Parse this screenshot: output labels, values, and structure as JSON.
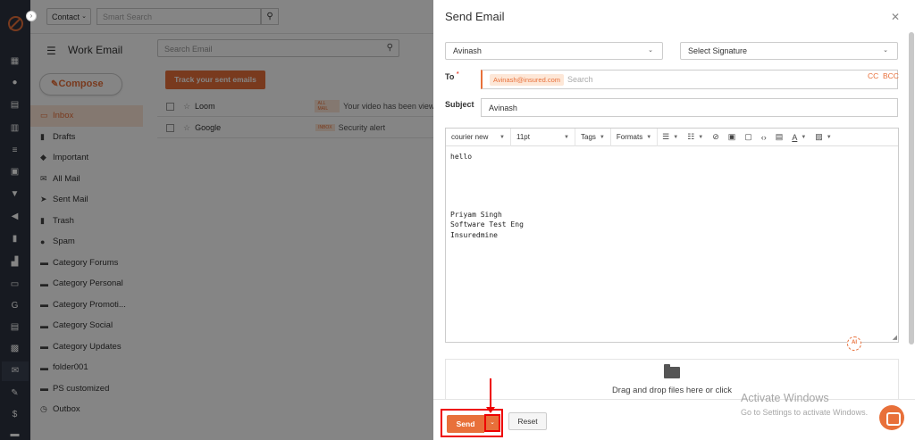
{
  "topbar": {
    "contact_select": "Contact",
    "smart_search_placeholder": "Smart Search"
  },
  "mail": {
    "title": "Work Email",
    "search_placeholder": "Search Email",
    "compose_label": "Compose",
    "track_label": "Track your sent emails",
    "folders": [
      {
        "label": "Inbox",
        "icon": "inbox-icon"
      },
      {
        "label": "Drafts",
        "icon": "draft-icon"
      },
      {
        "label": "Important",
        "icon": "tag-icon"
      },
      {
        "label": "All Mail",
        "icon": "mail-icon"
      },
      {
        "label": "Sent Mail",
        "icon": "send-icon"
      },
      {
        "label": "Trash",
        "icon": "trash-icon"
      },
      {
        "label": "Spam",
        "icon": "spam-icon"
      },
      {
        "label": "Category Forums",
        "icon": "folder-icon"
      },
      {
        "label": "Category Personal",
        "icon": "folder-icon"
      },
      {
        "label": "Category Promoti...",
        "icon": "folder-icon"
      },
      {
        "label": "Category Social",
        "icon": "folder-icon"
      },
      {
        "label": "Category Updates",
        "icon": "folder-icon"
      },
      {
        "label": "folder001",
        "icon": "folder-icon"
      },
      {
        "label": "PS customized",
        "icon": "folder-icon"
      },
      {
        "label": "Outbox",
        "icon": "clock-icon"
      }
    ],
    "messages": [
      {
        "from": "Loom",
        "tag": "ALL MAIL",
        "subject": "Your video has been view"
      },
      {
        "from": "Google",
        "tag": "INBOX",
        "subject": "Security alert"
      }
    ]
  },
  "modal": {
    "title": "Send Email",
    "from_select": "Avinash",
    "signature_select": "Select Signature",
    "to_label": "To",
    "to_required": "*",
    "to_chip": "Avinash@insured.com",
    "to_placeholder": "Search",
    "cc_label": "CC",
    "bcc_label": "BCC",
    "subject_label": "Subject",
    "subject_value": "Avinash",
    "toolbar": {
      "font_family": "courier new",
      "font_size": "11pt",
      "tags": "Tags",
      "formats": "Formats"
    },
    "body_lines": [
      "hello",
      "Priyam Singh",
      "Software Test Eng",
      "Insuredmine"
    ],
    "ai_badge": "AI",
    "dropzone_text": "Drag and drop files here or click",
    "send_label": "Send",
    "reset_label": "Reset"
  },
  "watermark": {
    "line1": "Activate Windows",
    "line2": "Go to Settings to activate Windows."
  },
  "colors": {
    "accent": "#e8703a",
    "rail": "#2d3340",
    "highlight": "#ee0000"
  }
}
